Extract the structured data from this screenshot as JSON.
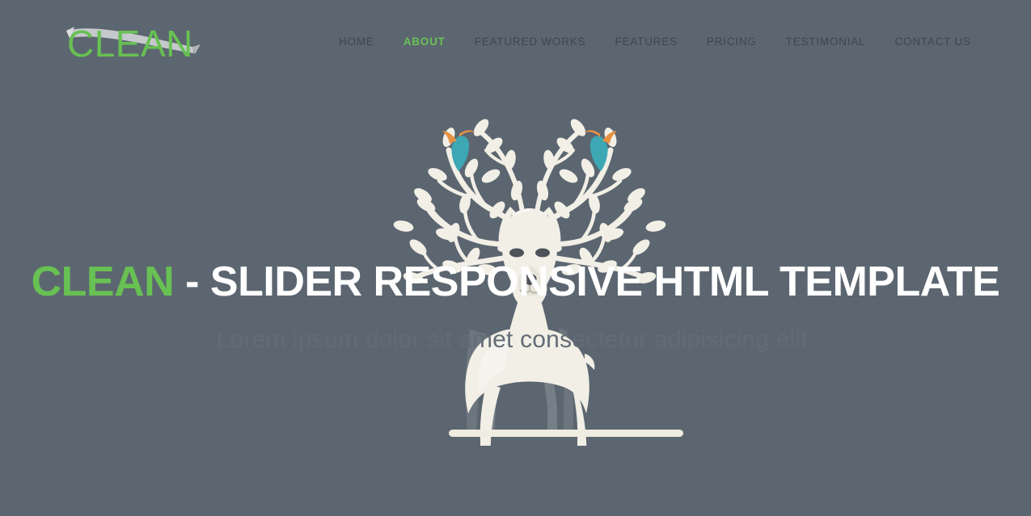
{
  "theme": {
    "background": "#5c6670",
    "accent_green": "#68c153",
    "nav_text": "#3f464f",
    "heading_white": "#ffffff",
    "subtitle_muted": "#626c76",
    "illustration_cream": "#f1efe6",
    "illustration_shadow": "#6d757e",
    "bird_body_teal": "#3da7b4",
    "bird_head_orange": "#e79243",
    "logo_ribbon_grey": "#c9cbcc"
  },
  "header": {
    "logo": {
      "text": "CLEAN",
      "ribbon_icon": "swoosh-ribbon"
    },
    "nav": [
      {
        "label": "HOME",
        "active": false
      },
      {
        "label": "ABOUT",
        "active": true
      },
      {
        "label": "FEATURED WORKS",
        "active": false
      },
      {
        "label": "FEATURES",
        "active": false
      },
      {
        "label": "PRICING",
        "active": false
      },
      {
        "label": "TESTIMONIAL",
        "active": false
      },
      {
        "label": "CONTACT US",
        "active": false
      }
    ]
  },
  "hero": {
    "title_accent": "CLEAN",
    "title_rest": " - SLIDER RESPONSIVE HTML TEMPLATE",
    "subtitle": "Lorem ipsum dolor sit amet consectetur adipisicing elit.",
    "illustration": {
      "name": "deer-with-branch-antlers",
      "elements": [
        "antler-branches",
        "leaves",
        "perched-bird-left",
        "perched-bird-right",
        "deer-head",
        "deer-body",
        "ground-bar"
      ]
    }
  }
}
